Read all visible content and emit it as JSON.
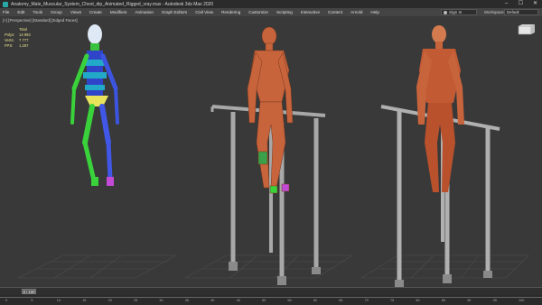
{
  "window": {
    "title": "Anatomy_Male_Muscular_System_Chest_dip_Animated_Rigged_vray.max - Autodesk 3ds Max 2020",
    "controls": [
      "–",
      "☐",
      "✕"
    ]
  },
  "menu": [
    "File",
    "Edit",
    "Tools",
    "Group",
    "Views",
    "Create",
    "Modifiers",
    "Animation",
    "Graph Editors",
    "Civil View",
    "Rendering",
    "Customize",
    "Scripting",
    "Interactive",
    "Content",
    "Arnold",
    "Help"
  ],
  "signin": {
    "label": "Sign In"
  },
  "workspaces": {
    "label": "Workspaces:",
    "value": "Default"
  },
  "viewport": {
    "label": "[+] [Perspective] [Standard] [Edged Faces]",
    "stats": [
      {
        "k": "",
        "v": "Total"
      },
      {
        "k": "Polys:",
        "v": "14 992"
      },
      {
        "k": "Verts:",
        "v": "7 777"
      },
      {
        "k": "",
        "v": ""
      },
      {
        "k": "FPS:",
        "v": "1.267"
      }
    ]
  },
  "timeslider": {
    "frame": "0 / 100",
    "ticks": [
      "0",
      "5",
      "10",
      "15",
      "20",
      "25",
      "30",
      "35",
      "40",
      "45",
      "50",
      "55",
      "60",
      "65",
      "70",
      "75",
      "80",
      "85",
      "90",
      "95",
      "100"
    ]
  },
  "colors": {
    "accent": "#2aa7a7",
    "skin": "#c8643c",
    "bar": "#a8a8a8"
  }
}
